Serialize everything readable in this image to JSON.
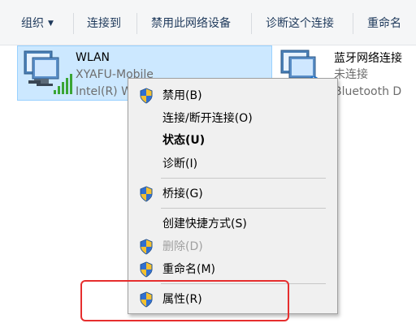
{
  "toolbar": {
    "organize": "组织",
    "connect_to": "连接到",
    "disable_device": "禁用此网络设备",
    "diagnose": "诊断这个连接",
    "rename": "重命名"
  },
  "adapters": [
    {
      "name": "WLAN",
      "network": "XYAFU-Mobile",
      "device": "Intel(R) W"
    },
    {
      "name": "蓝牙网络连接",
      "network": "未连接",
      "device": "Bluetooth D"
    }
  ],
  "context_menu": {
    "items": [
      {
        "label": "禁用(B)"
      },
      {
        "label": "连接/断开连接(O)"
      },
      {
        "label": "状态(U)"
      },
      {
        "label": "诊断(I)"
      },
      {
        "label": "桥接(G)"
      },
      {
        "label": "创建快捷方式(S)"
      },
      {
        "label": "删除(D)"
      },
      {
        "label": "重命名(M)"
      },
      {
        "label": "属性(R)"
      }
    ]
  },
  "colors": {
    "selection_bg": "#cce8ff",
    "menu_bg": "#f0f0f0",
    "highlight_border": "#e62e2e",
    "toolbar_text": "#1e395b"
  }
}
